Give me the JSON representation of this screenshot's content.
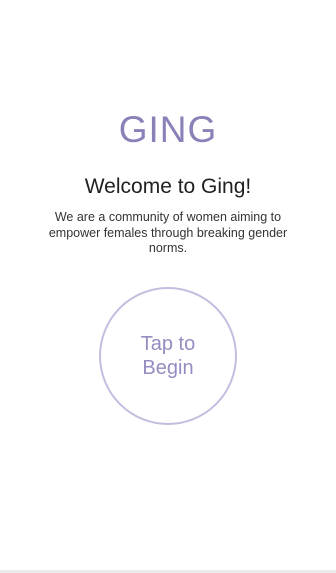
{
  "app": {
    "logo_text": "GING",
    "brand_color": "#8b80b8"
  },
  "welcome": {
    "title": "Welcome to Ging!",
    "tagline": "We are a community of women aiming to empower females through breaking gender norms."
  },
  "start": {
    "button_label": "Tap to Begin",
    "ring_color": "#c3bde0",
    "label_color": "#958cc1"
  }
}
